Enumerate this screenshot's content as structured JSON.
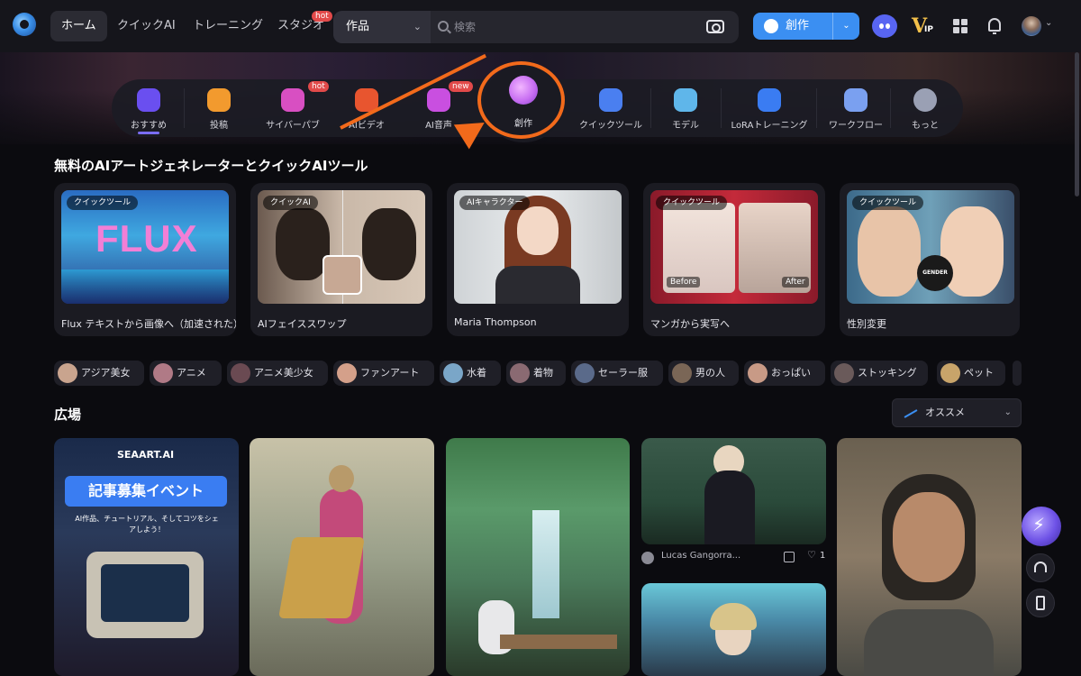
{
  "header": {
    "nav": [
      {
        "label": "ホーム",
        "active": true
      },
      {
        "label": "クイックAI",
        "active": false
      },
      {
        "label": "トレーニング",
        "active": false
      },
      {
        "label": "スタジオ",
        "active": false,
        "badge": "hot"
      }
    ],
    "search": {
      "scope": "作品",
      "placeholder": "検索"
    },
    "create_button": {
      "label": "創作"
    },
    "icons": [
      "discord-icon",
      "vip-icon",
      "grid-icon",
      "bell-icon",
      "avatar"
    ],
    "vip_text": "IP"
  },
  "categories": [
    {
      "label": "おすすめ",
      "icon": "star-icon",
      "color": "#6a4ff0",
      "active": true
    },
    {
      "label": "投稿",
      "icon": "post-icon",
      "color": "#f29a2e"
    },
    {
      "label": "サイバーパブ",
      "icon": "chat-icon",
      "color": "#d84fc2",
      "badge": "hot"
    },
    {
      "label": "AIビデオ",
      "icon": "video-icon",
      "color": "#e8552f"
    },
    {
      "label": "AI音声",
      "icon": "audio-icon",
      "color": "#c94fe0",
      "badge": "new"
    },
    {
      "label": "創作",
      "icon": "palette-icon",
      "color": "#c86ff2"
    },
    {
      "label": "クイックツール",
      "icon": "ai-icon",
      "color": "#4a7ff0"
    },
    {
      "label": "モデル",
      "icon": "cube-icon",
      "color": "#5fb6ea"
    },
    {
      "label": "LoRAトレーニング",
      "icon": "lora-icon",
      "color": "#3a7cf2"
    },
    {
      "label": "ワークフロー",
      "icon": "workflow-icon",
      "color": "#7aa0f0"
    },
    {
      "label": "もっと",
      "icon": "more-icon",
      "color": "#9aa0b4"
    }
  ],
  "section_tools": {
    "title": "無料のAIアートジェネレーターとクイックAIツール",
    "cards": [
      {
        "tag": "クイックツール",
        "name": "Flux テキストから画像へ（加速された）",
        "thumb_text": "FLUX"
      },
      {
        "tag": "クイックAI",
        "name": "AIフェイススワップ"
      },
      {
        "tag": "AIキャラクター",
        "name": "Maria Thompson"
      },
      {
        "tag": "クイックツール",
        "name": "マンガから実写へ",
        "before": "Before",
        "after": "After"
      },
      {
        "tag": "クイックツール",
        "name": "性別変更",
        "logo_text": "GENDER SWAP"
      }
    ]
  },
  "chips": [
    "アジア美女",
    "アニメ",
    "アニメ美少女",
    "ファンアート",
    "水着",
    "着物",
    "セーラー服",
    "男の人",
    "おっぱい",
    "ストッキング",
    "ペット"
  ],
  "plaza": {
    "title": "広場",
    "sort": {
      "label": "オススメ"
    },
    "event_card": {
      "brand": "SEAART.AI",
      "headline": "記事募集イベント",
      "sub": "AI作品、チュートリアル、そしてコツをシェアしよう！"
    },
    "post_meta": {
      "user": "Lucas Gangorra...",
      "likes": "1"
    }
  }
}
